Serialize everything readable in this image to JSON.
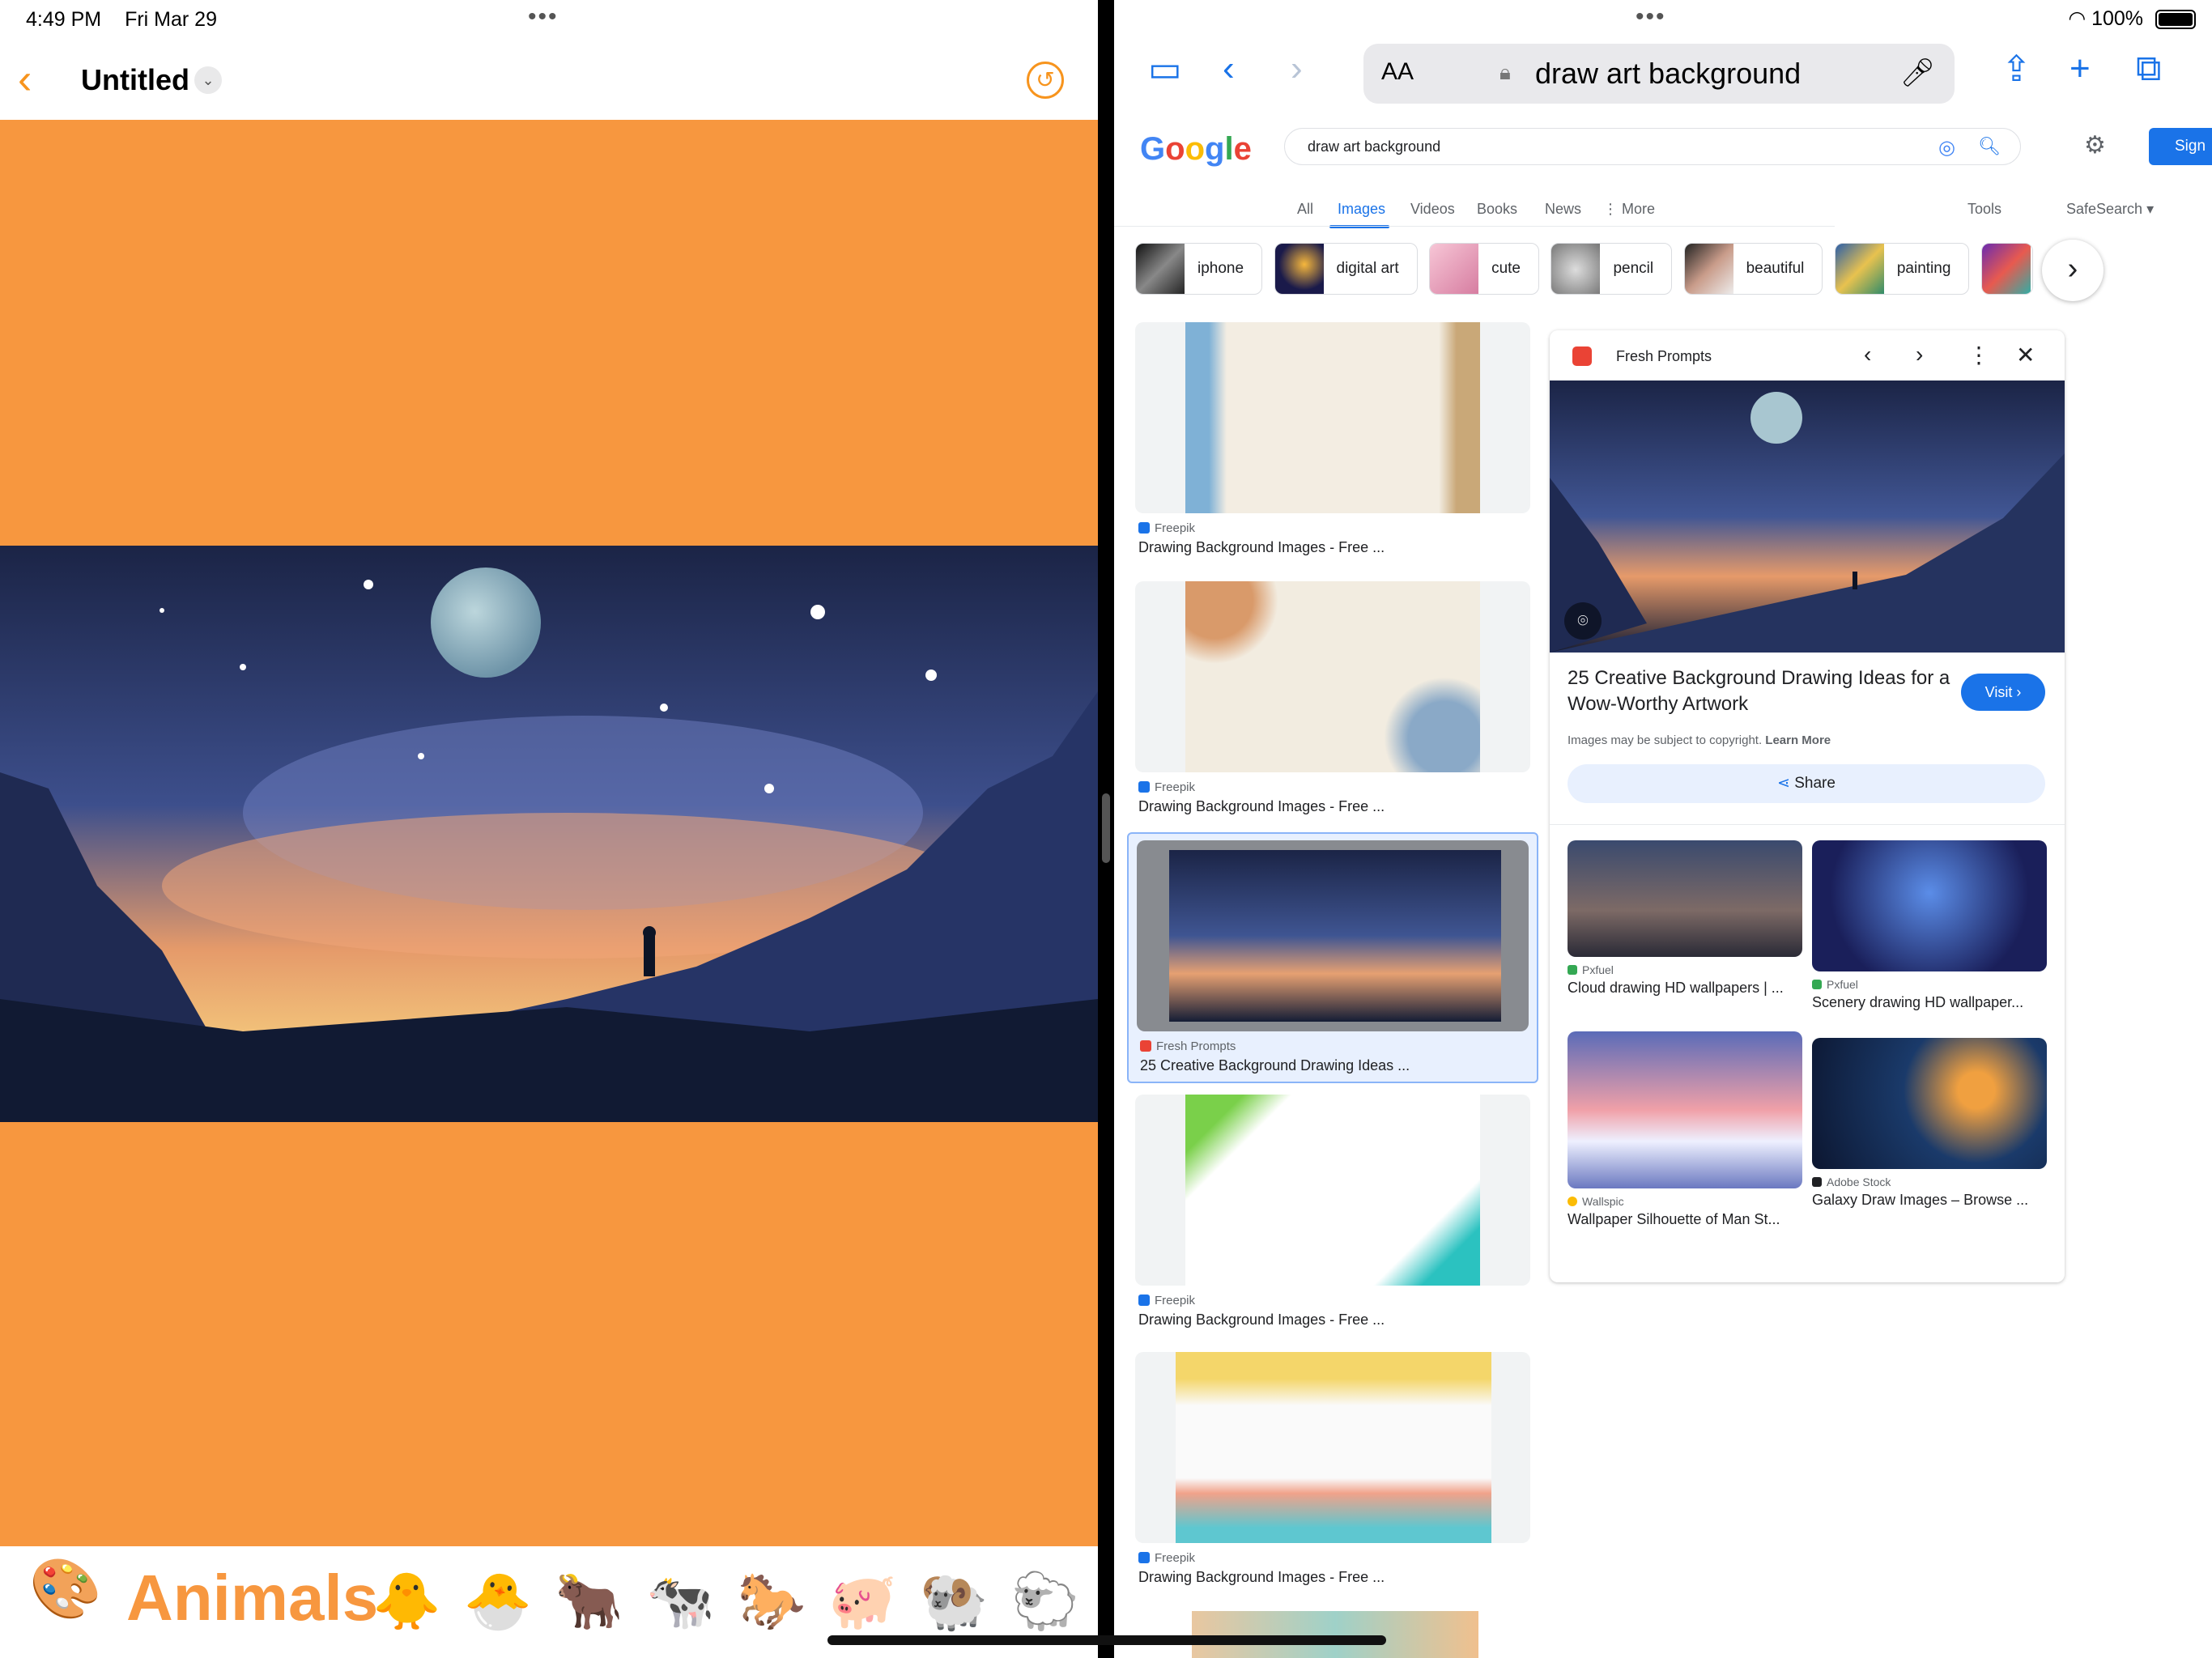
{
  "left_app": {
    "status_time": "4:49 PM",
    "status_date": "Fri Mar 29",
    "doc_title": "Untitled",
    "canvas_color": "#f7973f",
    "accent_color": "#f7941d",
    "category_label": "Animals",
    "emojis": "🐥🐣🐂🐄🐎🐖🐏🐑",
    "icons": [
      "back-chevron-icon",
      "title-dropdown-icon",
      "undo-icon",
      "palette-icon"
    ]
  },
  "browser": {
    "battery": "100%",
    "url_aa": "AA",
    "url_query": "draw art background",
    "icons": [
      "sidebar-icon",
      "back-icon",
      "forward-icon",
      "lock-icon",
      "search-icon",
      "mic-icon",
      "share-icon",
      "new-tab-icon",
      "tabs-icon"
    ]
  },
  "google": {
    "logo": "Google",
    "query": "draw art background",
    "sign_in": "Sign",
    "tabs": [
      "All",
      "Images",
      "Videos",
      "Books",
      "News",
      "More"
    ],
    "tools": "Tools",
    "safesearch": "SafeSearch",
    "chips": [
      "iphone",
      "digital art",
      "cute",
      "pencil",
      "beautiful",
      "painting"
    ],
    "results": [
      {
        "source": "Freepik",
        "caption": "Drawing Background Images - Free ..."
      },
      {
        "source": "Freepik",
        "caption": "Drawing Background Images - Free ..."
      },
      {
        "source": "Fresh Prompts",
        "caption": "25 Creative Background Drawing Ideas ..."
      },
      {
        "source": "Freepik",
        "caption": "Drawing Background Images - Free ..."
      },
      {
        "source": "Freepik",
        "caption": "Drawing Background Images - Free ..."
      }
    ],
    "preview": {
      "source": "Fresh Prompts",
      "title": "25 Creative Background Drawing Ideas for a Wow-Worthy Artwork",
      "visit": "Visit",
      "copyright": "Images may be subject to copyright.",
      "learn_more": "Learn More",
      "share": "Share",
      "related": [
        {
          "source": "Pxfuel",
          "caption": "Cloud drawing HD wallpapers | ..."
        },
        {
          "source": "Pxfuel",
          "caption": "Scenery drawing HD wallpaper..."
        },
        {
          "source": "Wallspic",
          "caption": "Wallpaper Silhouette of Man St..."
        },
        {
          "source": "Adobe Stock",
          "caption": "Galaxy Draw Images – Browse ..."
        }
      ]
    }
  }
}
